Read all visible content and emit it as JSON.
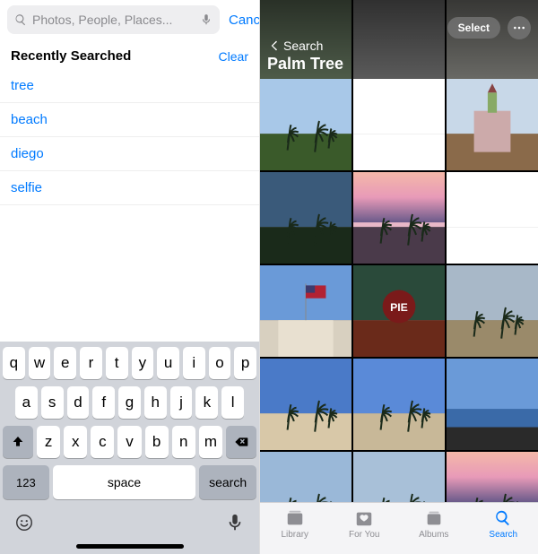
{
  "left": {
    "search": {
      "placeholder": "Photos, People, Places...",
      "value": "",
      "cancel_label": "Cancel"
    },
    "recent": {
      "header": "Recently Searched",
      "clear_label": "Clear",
      "items": [
        "tree",
        "beach",
        "diego",
        "selfie"
      ]
    },
    "keyboard": {
      "row1": [
        "q",
        "w",
        "e",
        "r",
        "t",
        "y",
        "u",
        "i",
        "o",
        "p"
      ],
      "row2": [
        "a",
        "s",
        "d",
        "f",
        "g",
        "h",
        "j",
        "k",
        "l"
      ],
      "row3": [
        "z",
        "x",
        "c",
        "v",
        "b",
        "n",
        "m"
      ],
      "numkey_label": "123",
      "space_label": "space",
      "search_label": "search"
    }
  },
  "right": {
    "back_label": "Search",
    "title": "Palm Tree",
    "select_label": "Select",
    "tabs": {
      "library": "Library",
      "for_you": "For You",
      "albums": "Albums",
      "search": "Search"
    },
    "thumbs": [
      {
        "name": "palm-sunset-1",
        "sky": "#a8c8e8",
        "ground": "#3a5a2a",
        "palm": true
      },
      {
        "name": "white-1",
        "sky": "#ffffff",
        "ground": "#ffffff",
        "palm": false
      },
      {
        "name": "tower-building",
        "sky": "#c8d8e8",
        "ground": "#8a6a4a",
        "palm": false,
        "tower": true
      },
      {
        "name": "palm-silhouette",
        "sky": "#3a5a7a",
        "ground": "#1a2a1a",
        "palm": true
      },
      {
        "name": "sunset-palms-1",
        "sky": "#e8b8c8",
        "ground": "#4a3a4a",
        "palm": true,
        "sunset": true
      },
      {
        "name": "white-2",
        "sky": "#ffffff",
        "ground": "#ffffff",
        "palm": false
      },
      {
        "name": "flag-building",
        "sky": "#6a9ad8",
        "ground": "#d8d0c0",
        "palm": false,
        "flag": true
      },
      {
        "name": "pie-sign",
        "sky": "#2a4a3a",
        "ground": "#6a2a1a",
        "palm": false,
        "sign": "PIE"
      },
      {
        "name": "street-palms",
        "sky": "#a8b8c8",
        "ground": "#9a8a6a",
        "palm": true
      },
      {
        "name": "beach-palms-1",
        "sky": "#4a7ac8",
        "ground": "#d8c8a8",
        "palm": true
      },
      {
        "name": "beach-palms-2",
        "sky": "#5a8ad8",
        "ground": "#c8b898",
        "palm": true
      },
      {
        "name": "ocean-rocks",
        "sky": "#6a9ad8",
        "ground": "#2a2a2a",
        "palm": false,
        "ocean": true
      },
      {
        "name": "lava-rock-1",
        "sky": "#9ab8d8",
        "ground": "#2a2a2a",
        "palm": true,
        "ocean": true
      },
      {
        "name": "lava-rock-2",
        "sky": "#a8c0d8",
        "ground": "#2a2a2a",
        "palm": true,
        "ocean": true
      },
      {
        "name": "sunset-palms-2",
        "sky": "#d8c8b8",
        "ground": "#4a5a6a",
        "palm": true,
        "sunset": true
      }
    ]
  }
}
